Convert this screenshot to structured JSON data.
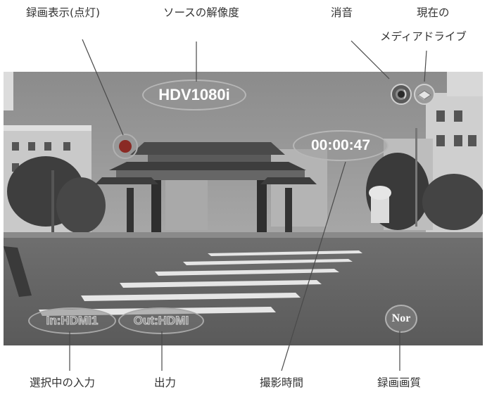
{
  "callouts": {
    "recording_indicator": "録画表示(点灯)",
    "source_resolution": "ソースの解像度",
    "mute": "消音",
    "media_line1": "現在の",
    "media_line2": "メディアドライブ",
    "selected_input": "選択中の入力",
    "output": "出力",
    "recording_time": "撮影時間",
    "recording_quality": "録画画質"
  },
  "osd": {
    "resolution": "HDV1080i",
    "timer": "00:00:47",
    "input": "In:HDMI1",
    "output": "Out:HDMI",
    "quality": "Nor",
    "mute_icon": "speaker-mute-icon",
    "media_icon": "media-drive-icon",
    "rec_color": "#8a2a24"
  }
}
